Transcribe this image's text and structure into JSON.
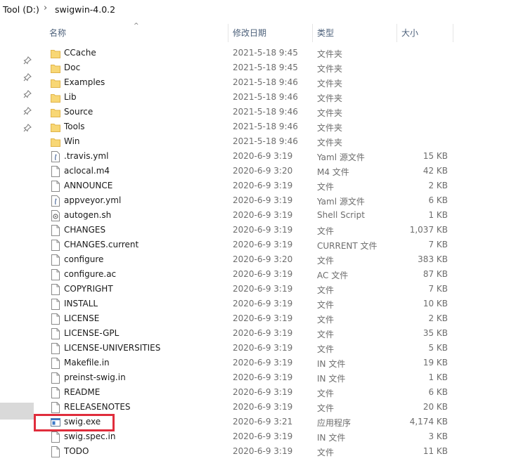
{
  "breadcrumb": {
    "drive": "Tool (D:)",
    "folder": "swigwin-4.0.2"
  },
  "columns": {
    "name": "名称",
    "date": "修改日期",
    "type": "类型",
    "size": "大小"
  },
  "colors": {
    "highlight": "#e02d3c",
    "folder": "#f8d775",
    "header_text": "#4c607a"
  },
  "files": [
    {
      "name": "CCache",
      "date": "2021-5-18 9:45",
      "type": "文件夹",
      "size": "",
      "icon": "folder-icon"
    },
    {
      "name": "Doc",
      "date": "2021-5-18 9:45",
      "type": "文件夹",
      "size": "",
      "icon": "folder-icon"
    },
    {
      "name": "Examples",
      "date": "2021-5-18 9:46",
      "type": "文件夹",
      "size": "",
      "icon": "folder-icon"
    },
    {
      "name": "Lib",
      "date": "2021-5-18 9:46",
      "type": "文件夹",
      "size": "",
      "icon": "folder-icon"
    },
    {
      "name": "Source",
      "date": "2021-5-18 9:46",
      "type": "文件夹",
      "size": "",
      "icon": "folder-icon"
    },
    {
      "name": "Tools",
      "date": "2021-5-18 9:46",
      "type": "文件夹",
      "size": "",
      "icon": "folder-icon"
    },
    {
      "name": "Win",
      "date": "2021-5-18 9:46",
      "type": "文件夹",
      "size": "",
      "icon": "folder-icon"
    },
    {
      "name": ".travis.yml",
      "date": "2020-6-9 3:19",
      "type": "Yaml 源文件",
      "size": "15 KB",
      "icon": "yaml-file-icon"
    },
    {
      "name": "aclocal.m4",
      "date": "2020-6-9 3:20",
      "type": "M4 文件",
      "size": "42 KB",
      "icon": "file-icon"
    },
    {
      "name": "ANNOUNCE",
      "date": "2020-6-9 3:19",
      "type": "文件",
      "size": "2 KB",
      "icon": "file-icon"
    },
    {
      "name": "appveyor.yml",
      "date": "2020-6-9 3:19",
      "type": "Yaml 源文件",
      "size": "6 KB",
      "icon": "yaml-file-icon"
    },
    {
      "name": "autogen.sh",
      "date": "2020-6-9 3:19",
      "type": "Shell Script",
      "size": "1 KB",
      "icon": "script-file-icon"
    },
    {
      "name": "CHANGES",
      "date": "2020-6-9 3:19",
      "type": "文件",
      "size": "1,037 KB",
      "icon": "file-icon"
    },
    {
      "name": "CHANGES.current",
      "date": "2020-6-9 3:19",
      "type": "CURRENT 文件",
      "size": "7 KB",
      "icon": "file-icon"
    },
    {
      "name": "configure",
      "date": "2020-6-9 3:20",
      "type": "文件",
      "size": "383 KB",
      "icon": "file-icon"
    },
    {
      "name": "configure.ac",
      "date": "2020-6-9 3:19",
      "type": "AC 文件",
      "size": "87 KB",
      "icon": "file-icon"
    },
    {
      "name": "COPYRIGHT",
      "date": "2020-6-9 3:19",
      "type": "文件",
      "size": "7 KB",
      "icon": "file-icon"
    },
    {
      "name": "INSTALL",
      "date": "2020-6-9 3:19",
      "type": "文件",
      "size": "10 KB",
      "icon": "file-icon"
    },
    {
      "name": "LICENSE",
      "date": "2020-6-9 3:19",
      "type": "文件",
      "size": "2 KB",
      "icon": "file-icon"
    },
    {
      "name": "LICENSE-GPL",
      "date": "2020-6-9 3:19",
      "type": "文件",
      "size": "35 KB",
      "icon": "file-icon"
    },
    {
      "name": "LICENSE-UNIVERSITIES",
      "date": "2020-6-9 3:19",
      "type": "文件",
      "size": "5 KB",
      "icon": "file-icon"
    },
    {
      "name": "Makefile.in",
      "date": "2020-6-9 3:19",
      "type": "IN 文件",
      "size": "19 KB",
      "icon": "file-icon"
    },
    {
      "name": "preinst-swig.in",
      "date": "2020-6-9 3:19",
      "type": "IN 文件",
      "size": "1 KB",
      "icon": "file-icon"
    },
    {
      "name": "README",
      "date": "2020-6-9 3:19",
      "type": "文件",
      "size": "6 KB",
      "icon": "file-icon"
    },
    {
      "name": "RELEASENOTES",
      "date": "2020-6-9 3:19",
      "type": "文件",
      "size": "20 KB",
      "icon": "file-icon"
    },
    {
      "name": "swig.exe",
      "date": "2020-6-9 3:21",
      "type": "应用程序",
      "size": "4,174 KB",
      "icon": "exe-icon"
    },
    {
      "name": "swig.spec.in",
      "date": "2020-6-9 3:19",
      "type": "IN 文件",
      "size": "3 KB",
      "icon": "file-icon"
    },
    {
      "name": "TODO",
      "date": "2020-6-9 3:19",
      "type": "文件",
      "size": "11 KB",
      "icon": "file-icon"
    }
  ]
}
